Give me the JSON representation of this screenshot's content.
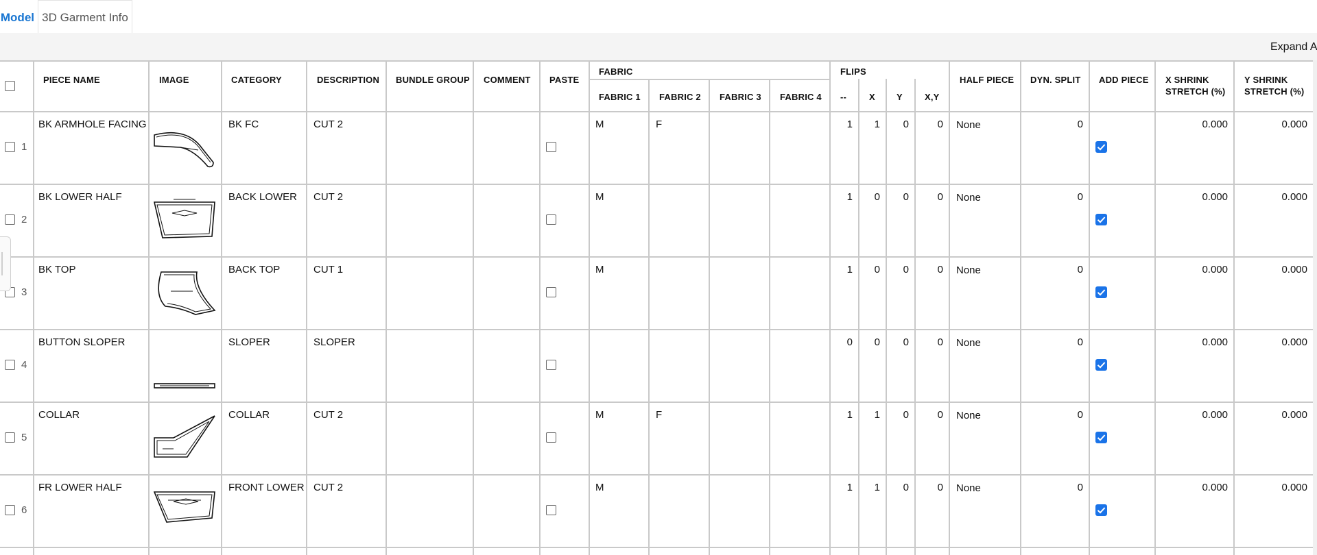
{
  "tabs": [
    {
      "label": "Model",
      "active": true
    },
    {
      "label": "3D Garment Info",
      "active": false
    }
  ],
  "toolbar": {
    "expand_label": "Expand Al"
  },
  "columns": {
    "piece_name": "PIECE NAME",
    "image": "IMAGE",
    "category": "CATEGORY",
    "description": "DESCRIPTION",
    "bundle_group": "BUNDLE GROUP",
    "comment": "COMMENT",
    "paste": "PASTE",
    "fabric": "FABRIC",
    "fabric_1": "FABRIC 1",
    "fabric_2": "FABRIC 2",
    "fabric_3": "FABRIC 3",
    "fabric_4": "FABRIC 4",
    "flips": "FLIPS",
    "flip_none": "--",
    "flip_x": "X",
    "flip_y": "Y",
    "flip_xy": "X,Y",
    "half_piece": "HALF PIECE",
    "dyn_split": "DYN. SPLIT",
    "add_piece": "ADD PIECE",
    "x_shrink_1": "X SHRINK",
    "x_shrink_2": "STRETCH (%)",
    "y_shrink_1": "Y SHRINK",
    "y_shrink_2": "STRETCH (%)"
  },
  "rows": [
    {
      "no": "1",
      "piece_name": "BK ARMHOLE FACING",
      "image": "armhole-facing-shape",
      "category": "BK FC",
      "description": "CUT 2",
      "paste": false,
      "fabric_1": "M",
      "fabric_2": "F",
      "fabric_3": "",
      "fabric_4": "",
      "flip_none": "1",
      "flip_x": "1",
      "flip_y": "0",
      "flip_xy": "0",
      "half_piece": "None",
      "dyn_split": "0",
      "add_piece": true,
      "x_shrink": "0.000",
      "y_shrink": "0.000"
    },
    {
      "no": "2",
      "piece_name": "BK LOWER HALF",
      "image": "back-lower-shape",
      "category": "BACK LOWER",
      "description": "CUT 2",
      "paste": false,
      "fabric_1": "M",
      "fabric_2": "",
      "fabric_3": "",
      "fabric_4": "",
      "flip_none": "1",
      "flip_x": "0",
      "flip_y": "0",
      "flip_xy": "0",
      "half_piece": "None",
      "dyn_split": "0",
      "add_piece": true,
      "x_shrink": "0.000",
      "y_shrink": "0.000"
    },
    {
      "no": "3",
      "piece_name": "BK TOP",
      "image": "back-top-shape",
      "category": "BACK TOP",
      "description": "CUT 1",
      "paste": false,
      "fabric_1": "M",
      "fabric_2": "",
      "fabric_3": "",
      "fabric_4": "",
      "flip_none": "1",
      "flip_x": "0",
      "flip_y": "0",
      "flip_xy": "0",
      "half_piece": "None",
      "dyn_split": "0",
      "add_piece": true,
      "x_shrink": "0.000",
      "y_shrink": "0.000"
    },
    {
      "no": "4",
      "piece_name": "BUTTON SLOPER",
      "image": "sloper-shape",
      "category": "SLOPER",
      "description": "SLOPER",
      "paste": false,
      "fabric_1": "",
      "fabric_2": "",
      "fabric_3": "",
      "fabric_4": "",
      "flip_none": "0",
      "flip_x": "0",
      "flip_y": "0",
      "flip_xy": "0",
      "half_piece": "None",
      "dyn_split": "0",
      "add_piece": true,
      "x_shrink": "0.000",
      "y_shrink": "0.000"
    },
    {
      "no": "5",
      "piece_name": "COLLAR",
      "image": "collar-shape",
      "category": "COLLAR",
      "description": "CUT 2",
      "paste": false,
      "fabric_1": "M",
      "fabric_2": "F",
      "fabric_3": "",
      "fabric_4": "",
      "flip_none": "1",
      "flip_x": "1",
      "flip_y": "0",
      "flip_xy": "0",
      "half_piece": "None",
      "dyn_split": "0",
      "add_piece": true,
      "x_shrink": "0.000",
      "y_shrink": "0.000"
    },
    {
      "no": "6",
      "piece_name": "FR LOWER HALF",
      "image": "front-lower-shape",
      "category": "FRONT LOWER",
      "description": "CUT 2",
      "paste": false,
      "fabric_1": "M",
      "fabric_2": "",
      "fabric_3": "",
      "fabric_4": "",
      "flip_none": "1",
      "flip_x": "1",
      "flip_y": "0",
      "flip_xy": "0",
      "half_piece": "None",
      "dyn_split": "0",
      "add_piece": true,
      "x_shrink": "0.000",
      "y_shrink": "0.000"
    }
  ],
  "colors": {
    "accent": "#1a73e8",
    "tab_active": "#1976d2",
    "grid_line": "#c9c9c9",
    "strip": "#f4f4f4"
  }
}
